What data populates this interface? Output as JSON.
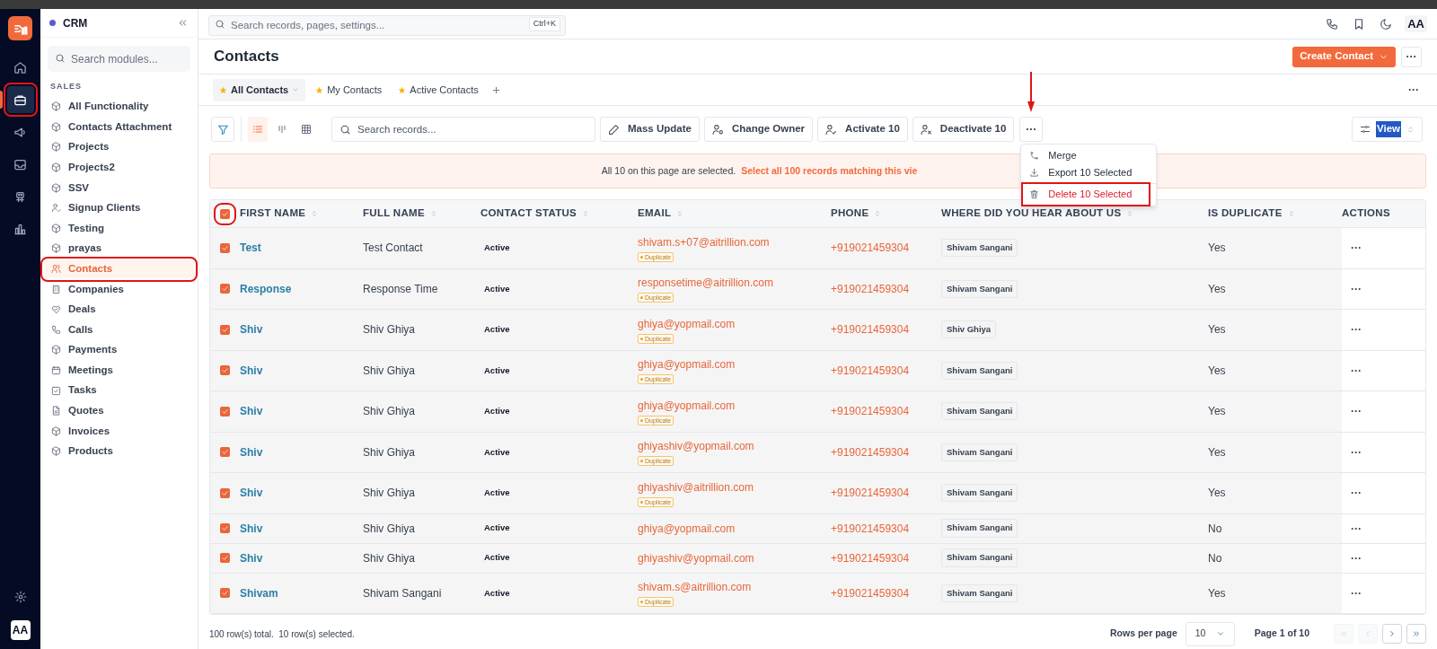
{
  "app": {
    "name": "CRM"
  },
  "rail": [
    {
      "selected": false,
      "annotated": false
    },
    {
      "selected": true,
      "annotated": true
    },
    {
      "selected": false,
      "annotated": false
    },
    {
      "selected": false,
      "annotated": false
    },
    {
      "selected": false,
      "annotated": false
    },
    {
      "selected": false,
      "annotated": false
    }
  ],
  "rail_avatar": "AA",
  "modules_search": {
    "placeholder": "Search modules..."
  },
  "modules_section": "SALES",
  "modules": [
    {
      "label": "All Functionality",
      "selected": false,
      "annotated": false
    },
    {
      "label": "Contacts Attachment",
      "selected": false,
      "annotated": false
    },
    {
      "label": "Projects",
      "selected": false,
      "annotated": false
    },
    {
      "label": "Projects2",
      "selected": false,
      "annotated": false
    },
    {
      "label": "SSV",
      "selected": false,
      "annotated": false
    },
    {
      "label": "Signup Clients",
      "selected": false,
      "annotated": false
    },
    {
      "label": "Testing",
      "selected": false,
      "annotated": false
    },
    {
      "label": "prayas",
      "selected": false,
      "annotated": false
    },
    {
      "label": "Contacts",
      "selected": true,
      "annotated": true
    },
    {
      "label": "Companies",
      "selected": false,
      "annotated": false
    },
    {
      "label": "Deals",
      "selected": false,
      "annotated": false
    },
    {
      "label": "Calls",
      "selected": false,
      "annotated": false
    },
    {
      "label": "Payments",
      "selected": false,
      "annotated": false
    },
    {
      "label": "Meetings",
      "selected": false,
      "annotated": false
    },
    {
      "label": "Tasks",
      "selected": false,
      "annotated": false
    },
    {
      "label": "Quotes",
      "selected": false,
      "annotated": false
    },
    {
      "label": "Invoices",
      "selected": false,
      "annotated": false
    },
    {
      "label": "Products",
      "selected": false,
      "annotated": false
    }
  ],
  "topbar": {
    "search_placeholder": "Search records, pages, settings...",
    "shortcut": "Ctrl+K",
    "avatar": "AA"
  },
  "page": {
    "title": "Contacts",
    "primary_button": "Create Contact",
    "more": "···"
  },
  "views_more": "···",
  "views": [
    {
      "label": "All Contacts",
      "selected": true
    },
    {
      "label": "My Contacts",
      "selected": false
    },
    {
      "label": "Active Contacts",
      "selected": false
    }
  ],
  "toolbar": {
    "layouts": [
      {
        "selected": true
      },
      {
        "selected": false
      },
      {
        "selected": false
      }
    ],
    "search_placeholder": "Search records...",
    "actions": [
      "Mass Update",
      "Change Owner",
      "Activate 10",
      "Deactivate 10"
    ],
    "more": "···",
    "view": "View"
  },
  "menu": {
    "items": [
      {
        "label": "Merge",
        "kind": "normal",
        "annotated": false
      },
      {
        "label": "Export 10 Selected",
        "kind": "normal",
        "annotated": false
      },
      {
        "label": "Delete 10 Selected",
        "kind": "danger",
        "annotated": true
      }
    ]
  },
  "banner": {
    "text": "All 10 on this page are selected.",
    "link": "Select all 100 records matching this vie"
  },
  "table": {
    "select_all": {
      "checked": true,
      "annotated": true
    },
    "columns": [
      {
        "label": "FIRST NAME",
        "sortable": true
      },
      {
        "label": "FULL NAME",
        "sortable": true
      },
      {
        "label": "CONTACT STATUS",
        "sortable": true
      },
      {
        "label": "EMAIL",
        "sortable": true
      },
      {
        "label": "PHONE",
        "sortable": true
      },
      {
        "label": "WHERE DID YOU HEAR ABOUT US",
        "sortable": true
      },
      {
        "label": "IS DUPLICATE",
        "sortable": true
      },
      {
        "label": "ACTIONS",
        "sortable": false
      }
    ],
    "rows": [
      {
        "selected": true,
        "first_name": "Test",
        "full_name": "Test Contact",
        "status": "Active",
        "email": "shivam.s+07@aitrillion.com",
        "badge": "Duplicate",
        "phone": "+919021459304",
        "source": "Shivam Sangani",
        "is_duplicate": "Yes",
        "actions": "···"
      },
      {
        "selected": true,
        "first_name": "Response",
        "full_name": "Response Time",
        "status": "Active",
        "email": "responsetime@aitrillion.com",
        "badge": "Duplicate",
        "phone": "+919021459304",
        "source": "Shivam Sangani",
        "is_duplicate": "Yes",
        "actions": "···"
      },
      {
        "selected": true,
        "first_name": "Shiv",
        "full_name": "Shiv Ghiya",
        "status": "Active",
        "email": "ghiya@yopmail.com",
        "badge": "Duplicate",
        "phone": "+919021459304",
        "source": "Shiv Ghiya",
        "is_duplicate": "Yes",
        "actions": "···"
      },
      {
        "selected": true,
        "first_name": "Shiv",
        "full_name": "Shiv Ghiya",
        "status": "Active",
        "email": "ghiya@yopmail.com",
        "badge": "Duplicate",
        "phone": "+919021459304",
        "source": "Shivam Sangani",
        "is_duplicate": "Yes",
        "actions": "···"
      },
      {
        "selected": true,
        "first_name": "Shiv",
        "full_name": "Shiv Ghiya",
        "status": "Active",
        "email": "ghiya@yopmail.com",
        "badge": "Duplicate",
        "phone": "+919021459304",
        "source": "Shivam Sangani",
        "is_duplicate": "Yes",
        "actions": "···"
      },
      {
        "selected": true,
        "first_name": "Shiv",
        "full_name": "Shiv Ghiya",
        "status": "Active",
        "email": "ghiyashiv@yopmail.com",
        "badge": "Duplicate",
        "phone": "+919021459304",
        "source": "Shivam Sangani",
        "is_duplicate": "Yes",
        "actions": "···"
      },
      {
        "selected": true,
        "first_name": "Shiv",
        "full_name": "Shiv Ghiya",
        "status": "Active",
        "email": "ghiyashiv@aitrillion.com",
        "badge": "Duplicate",
        "phone": "+919021459304",
        "source": "Shivam Sangani",
        "is_duplicate": "Yes",
        "actions": "···"
      },
      {
        "selected": true,
        "first_name": "Shiv",
        "full_name": "Shiv Ghiya",
        "status": "Active",
        "email": "ghiya@yopmail.com",
        "phone": "+919021459304",
        "source": "Shivam Sangani",
        "is_duplicate": "No",
        "actions": "···"
      },
      {
        "selected": true,
        "first_name": "Shiv",
        "full_name": "Shiv Ghiya",
        "status": "Active",
        "email": "ghiyashiv@yopmail.com",
        "phone": "+919021459304",
        "source": "Shivam Sangani",
        "is_duplicate": "No",
        "actions": "···"
      },
      {
        "selected": true,
        "first_name": "Shivam",
        "full_name": "Shivam Sangani",
        "status": "Active",
        "email": "shivam.s@aitrillion.com",
        "badge": "Duplicate",
        "phone": "+919021459304",
        "source": "Shivam Sangani",
        "is_duplicate": "Yes",
        "actions": "···"
      }
    ]
  },
  "footer": {
    "summary": "100 row(s) total.  10 row(s) selected.",
    "rows_per_page_label": "Rows per page",
    "rows_per_page": "10",
    "page": "Page 1 of 10"
  },
  "pager": [
    {
      "disabled": true
    },
    {
      "disabled": true
    },
    {
      "disabled": false
    },
    {
      "disabled": false
    }
  ]
}
